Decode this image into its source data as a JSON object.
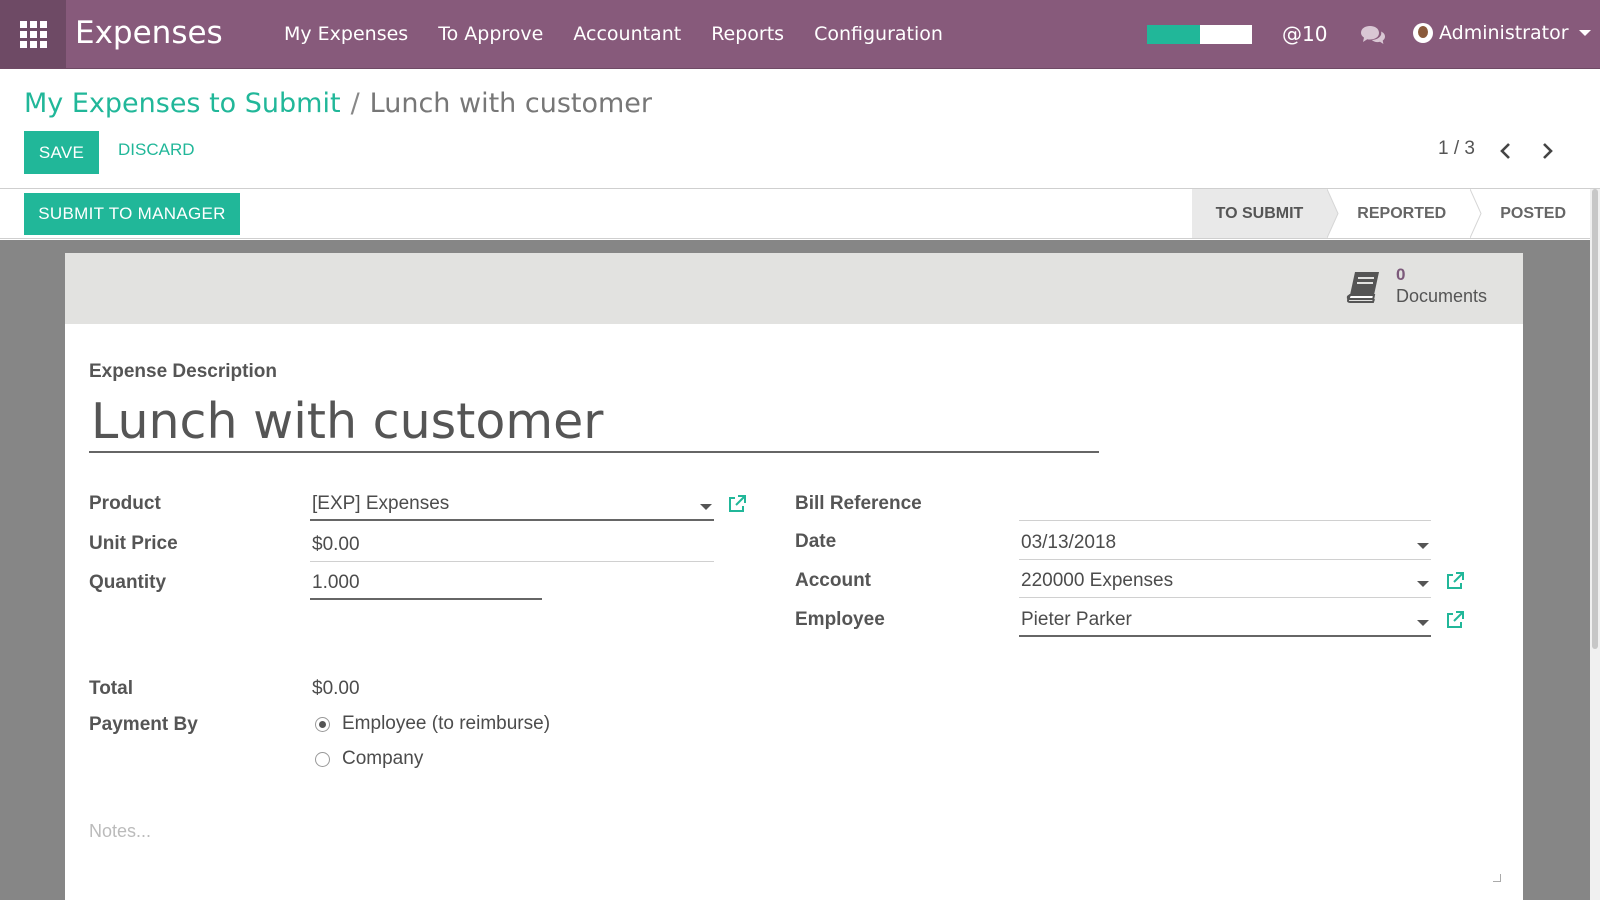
{
  "navbar": {
    "brand": "Expenses",
    "menu": [
      "My Expenses",
      "To Approve",
      "Accountant",
      "Reports",
      "Configuration"
    ],
    "progress_fraction": 0.5,
    "mentions": "@10",
    "user": "Administrator",
    "icons": {
      "apps": "apps-grid-icon",
      "chat": "chat-bubbles-icon",
      "user": "avatar"
    }
  },
  "breadcrumb": {
    "parent": "My Expenses to Submit",
    "separator": "/",
    "current": "Lunch with customer"
  },
  "actions": {
    "save": "SAVE",
    "discard": "DISCARD",
    "pager": "1 / 3"
  },
  "statusbar": {
    "submit": "SUBMIT TO MANAGER",
    "stages": [
      "TO SUBMIT",
      "REPORTED",
      "POSTED"
    ],
    "active_stage": "TO SUBMIT"
  },
  "documents": {
    "count": "0",
    "label": "Documents"
  },
  "form": {
    "description_label": "Expense Description",
    "description_value": "Lunch with customer",
    "product_label": "Product",
    "product_value": "[EXP] Expenses",
    "unit_price_label": "Unit Price",
    "unit_price_value": "$0.00",
    "quantity_label": "Quantity",
    "quantity_value": "1.000",
    "bill_reference_label": "Bill Reference",
    "bill_reference_value": "",
    "date_label": "Date",
    "date_value": "03/13/2018",
    "account_label": "Account",
    "account_value": "220000 Expenses",
    "employee_label": "Employee",
    "employee_value": "Pieter Parker",
    "total_label": "Total",
    "total_value": "$0.00",
    "payment_by_label": "Payment By",
    "payment_options": [
      "Employee (to reimburse)",
      "Company"
    ],
    "payment_selected": "Employee (to reimburse)",
    "notes_placeholder": "Notes..."
  },
  "colors": {
    "navbar": "#875a7b",
    "accent": "#21b799",
    "doc_count": "#7c5a7b"
  }
}
